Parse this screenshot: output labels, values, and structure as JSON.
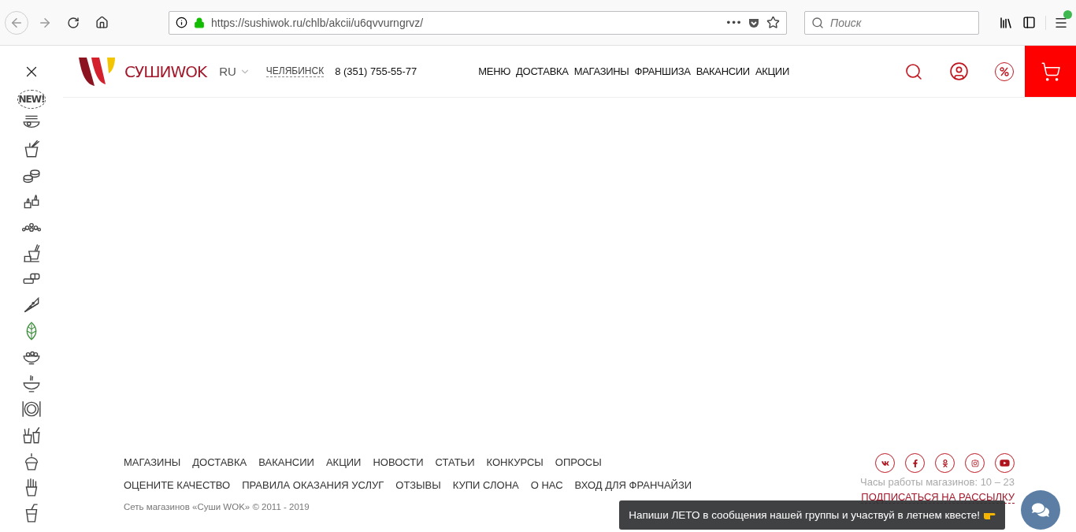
{
  "browser": {
    "url": "https://sushiwok.ru/chlb/akcii/u6qvvurngrvz/",
    "page_actions": "•••",
    "search": {
      "placeholder": "Поиск"
    }
  },
  "header": {
    "logo": "СУШИWOK",
    "language": "RU",
    "city": "ЧЕЛЯБИНСК",
    "phone": "8 (351) 755-55-77",
    "nav": [
      "МЕНЮ",
      "ДОСТАВКА",
      "МАГАЗИНЫ",
      "ФРАНШИЗА",
      "ВАКАНСИИ",
      "АКЦИИ"
    ]
  },
  "sidebar": {
    "new_badge": "NEW!"
  },
  "footer": {
    "links_row_1": [
      "МАГАЗИНЫ",
      "ДОСТАВКА",
      "ВАКАНСИИ",
      "АКЦИИ",
      "НОВОСТИ",
      "СТАТЬИ",
      "КОНКУРСЫ",
      "ОПРОСЫ"
    ],
    "links_row_2": [
      "ОЦЕНИТЕ КАЧЕСТВО",
      "ПРАВИЛА ОКАЗАНИЯ УСЛУГ",
      "ОТЗЫВЫ",
      "КУПИ СЛОНА",
      "О НАС",
      "ВХОД ДЛЯ ФРАНЧАЙЗИ"
    ],
    "copyright": "Сеть магазинов «Суши WOK» © 2011 - 2019",
    "hours": "Часы работы магазинов: 10 – 23",
    "subscribe": "ПОДПИСАТЬСЯ НА РАССЫЛКУ"
  },
  "chat_tooltip": "Напиши ЛЕТО в сообщения нашей группы и участвуй в летнем квесте!"
}
